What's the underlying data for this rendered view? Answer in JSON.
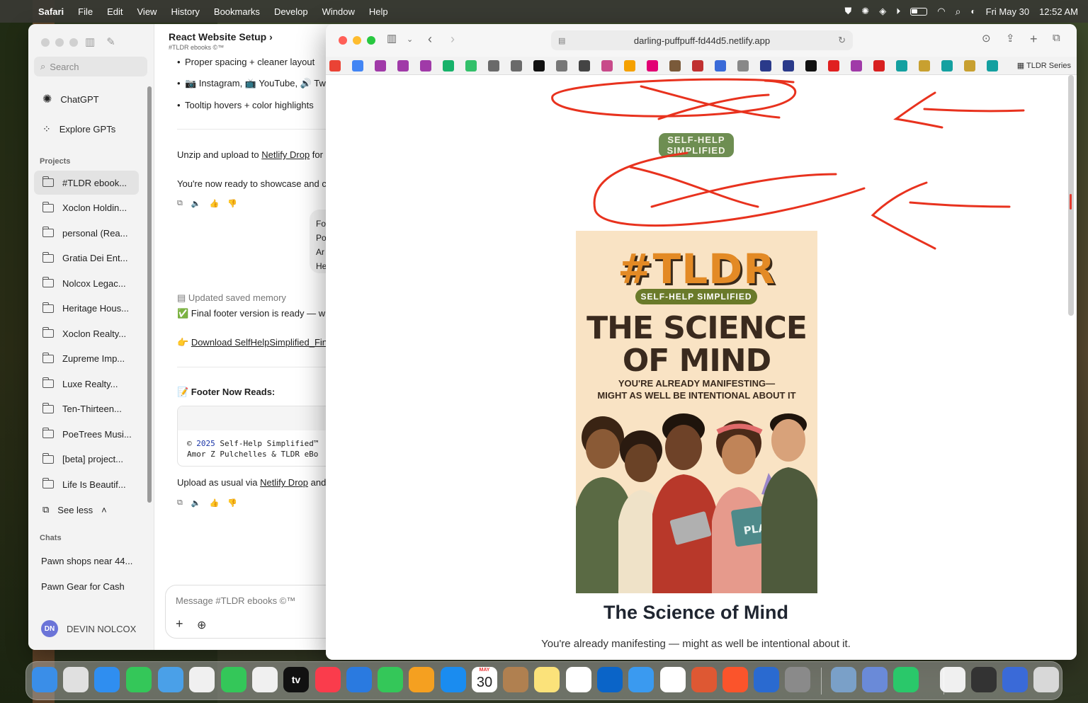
{
  "menubar": {
    "app": "Safari",
    "items": [
      "File",
      "Edit",
      "View",
      "History",
      "Bookmarks",
      "Develop",
      "Window",
      "Help"
    ],
    "date": "Fri May 30",
    "time": "12:52 AM"
  },
  "chatgpt": {
    "search_placeholder": "Search",
    "nav": {
      "chatgpt": "ChatGPT",
      "explore": "Explore GPTs"
    },
    "projects_heading": "Projects",
    "projects": [
      "#TLDR ebook...",
      "Xoclon Holdin...",
      "personal (Rea...",
      "Gratia Dei Ent...",
      "Nolcox Legac...",
      "Heritage Hous...",
      "Xoclon Realty...",
      "Zupreme Imp...",
      "Luxe Realty...",
      "Ten-Thirteen...",
      "PoeTrees Musi...",
      "[beta] project...",
      "Life Is Beautif..."
    ],
    "see_less": "See less",
    "chats_heading": "Chats",
    "chats": [
      "Pawn shops near 44...",
      "Pawn Gear for Cash"
    ],
    "user_initials": "DN",
    "user_name": "DEVIN NOLCOX",
    "conversation_title": "React Website Setup",
    "conversation_sub": "#TLDR ebooks ©™",
    "bullets": [
      "Proper spacing + cleaner layout",
      "📷 Instagram, 📺 YouTube, 🔊 Tw",
      "Tooltip hovers + color highlights"
    ],
    "unzip_prefix": "Unzip and upload to ",
    "netlify_drop": "Netlify Drop",
    "unzip_suffix": " for",
    "ready_line": "You're now ready to showcase and c",
    "user_bubble": [
      "Fo",
      "Po",
      "Ar",
      "He"
    ],
    "memory": "Updated saved memory",
    "final_footer": "✅ Final footer version is ready — wit",
    "download_link": "Download SelfHelpSimplified_Fin",
    "footer_heading": "📝 Footer Now Reads:",
    "code_year": "2025",
    "code_line1_rest": " Self-Help Simplified™",
    "code_line2": "Amor Z Pulchelles & TLDR eBo",
    "upload_prefix": "Upload as usual via ",
    "upload_suffix": " and",
    "composer_placeholder": "Message #TLDR ebooks ©™"
  },
  "safari": {
    "url": "darling-puffpuff-fd44d5.netlify.app",
    "favorites_last": "TLDR Series",
    "page": {
      "badge": [
        "SELF-HELP",
        "SIMPLIFIED"
      ],
      "cover_logo": "#TLDR",
      "cover_badge": "SELF-HELP SIMPLIFIED",
      "cover_title": [
        "THE SCIENCE",
        "OF MIND"
      ],
      "cover_subtitle": [
        "YOU'RE ALREADY MANIFESTING—",
        "MIGHT AS WELL BE INTENTIONAL ABOUT IT"
      ],
      "cover_planner": "PLANNER",
      "title": "The Science of Mind",
      "subtitle": "You're already manifesting — might as well be intentional about it."
    }
  },
  "dock": {
    "calendar_month": "MAY",
    "calendar_day": "30",
    "tv_label": "tv"
  }
}
